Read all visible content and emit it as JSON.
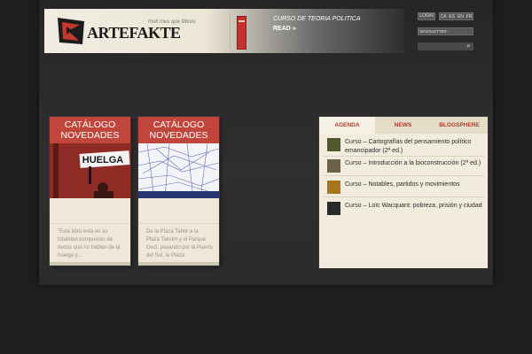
{
  "header": {
    "logo_text": "ARTEFAKTE",
    "tagline": "molt mes que llibres",
    "promo": {
      "title": "CURSO DE TEORIA POLITICA",
      "read": "READ »"
    }
  },
  "user_bar": {
    "login": "LOGIN",
    "languages": [
      "CA",
      "ES",
      "EN",
      "FR"
    ],
    "newsletter": "NEWSLETTER ›",
    "search_placeholder": "",
    "search_icon": "⌕"
  },
  "books": [
    {
      "category": [
        "CATÁLOGO",
        "NOVEDADES"
      ],
      "cover_text": "HUELGA",
      "excerpt": "\"Este libro está en su totalidad compuesto de textos que no hablan de la huelga y..."
    },
    {
      "category": [
        "CATÁLOGO",
        "NOVEDADES"
      ],
      "excerpt": "De la Plaza Tahrir a la Plaza Taksim y el Parque Gezi, pasando por la Puerta del Sol, la Plaza"
    }
  ],
  "tabs": [
    {
      "label": "AGENDA",
      "active": true
    },
    {
      "label": "NEWS",
      "active": false
    },
    {
      "label": "BLOGSPHERE",
      "active": false
    }
  ],
  "agenda": [
    {
      "text": "Curso – Cartografías del pensamiento político emancipador (2ª ed.)",
      "thumb_color": "#4f5a2c"
    },
    {
      "text": "Curso – Introducción a la bioconstrucción (2ª ed.)",
      "thumb_color": "#6b6248"
    },
    {
      "text": "Curso – Notables, partidos y movimientos",
      "thumb_color": "#a8741c"
    },
    {
      "text": "Curso – Loïc Wacquant: pobreza, prisión y ciudad",
      "thumb_color": "#2a2a2a"
    }
  ],
  "colors": {
    "accent_red": "#b0392f",
    "cover_red": "#c0463c",
    "page_bg": "#1e1e1e",
    "panel_bg": "#f2ecde"
  }
}
